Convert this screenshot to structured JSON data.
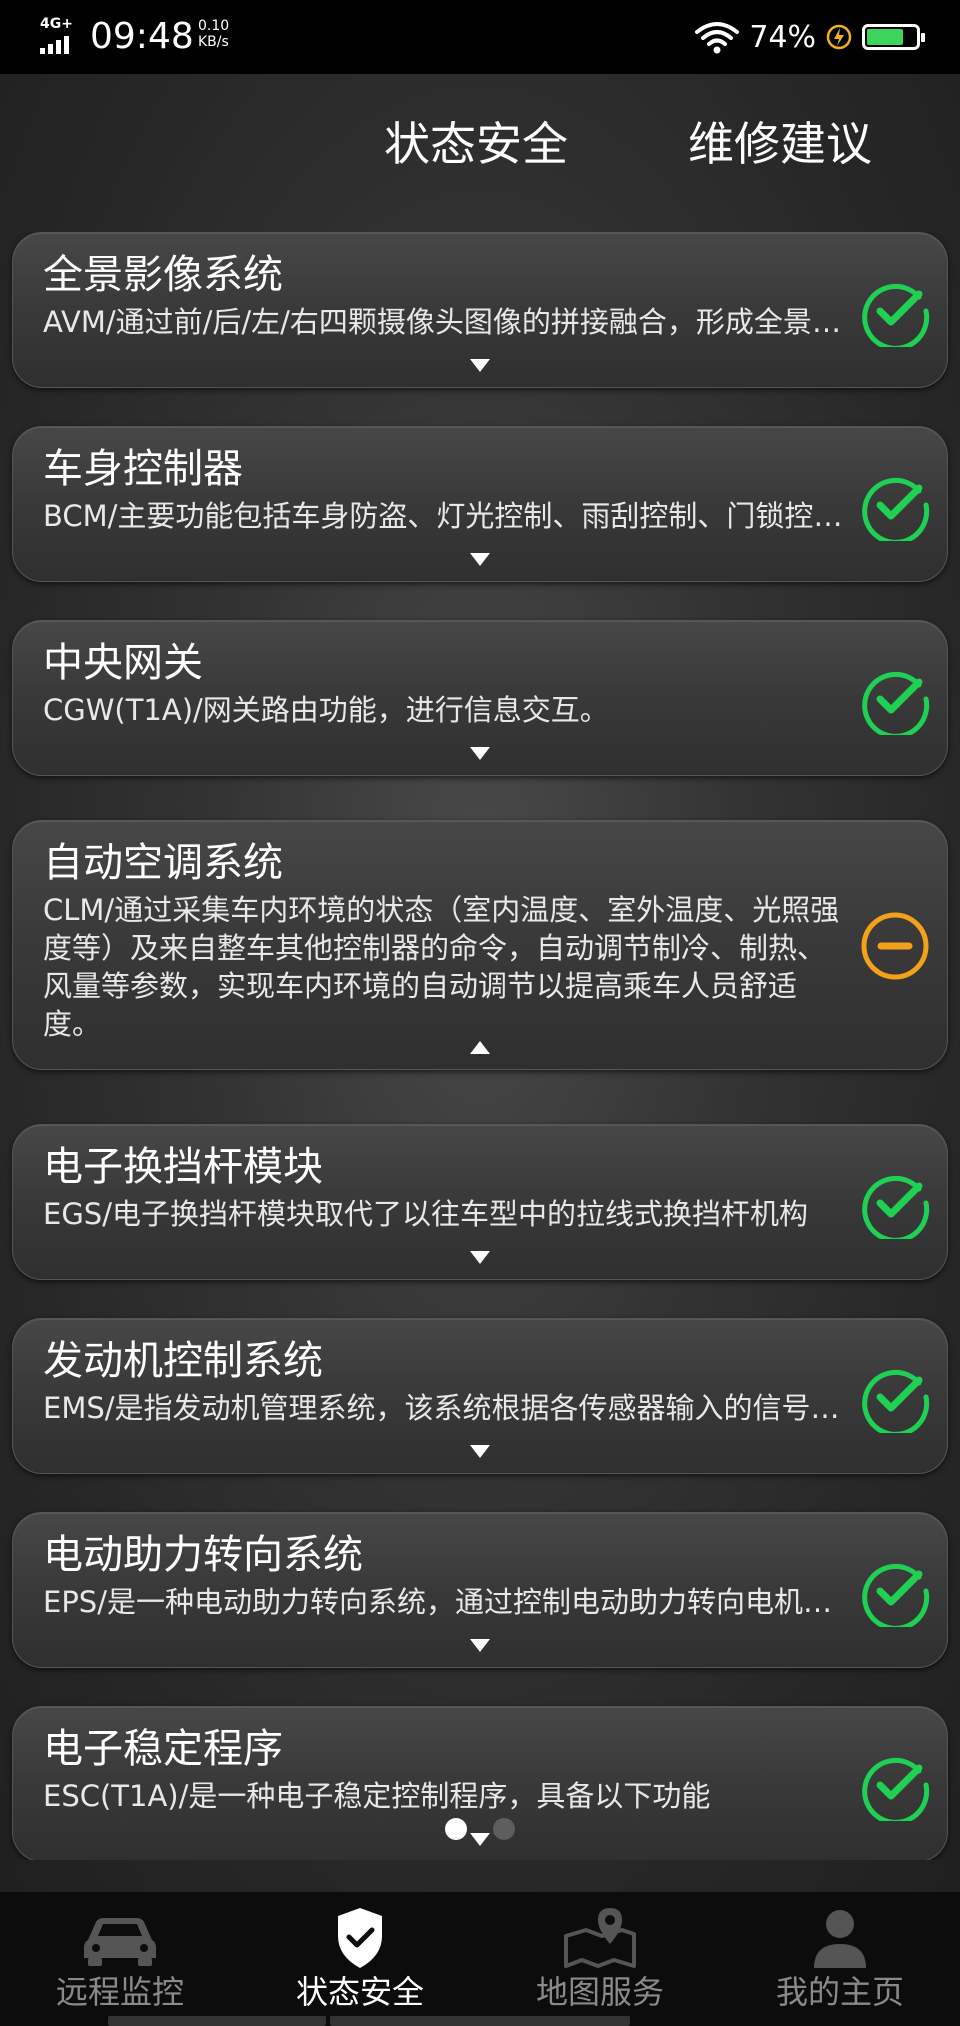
{
  "status_bar": {
    "network": "4G+",
    "time": "09:48",
    "speed_value": "0.10",
    "speed_unit": "KB/s",
    "battery_percent": "74%",
    "battery_level": 0.74,
    "battery_color": "#3cd45a"
  },
  "header": {
    "tabs": [
      {
        "label": "状态安全"
      },
      {
        "label": "维修建议"
      }
    ]
  },
  "colors": {
    "ok_green": "#1fd153",
    "warn_orange": "#f3a11b"
  },
  "systems": [
    {
      "title": "全景影像系统",
      "desc": "AVM/通过前/后/左/右四颗摄像头图像的拼接融合，形成全景影像并显示，辅助驾驶员泊车",
      "status": "ok",
      "expanded": false
    },
    {
      "title": "车身控制器",
      "desc": "BCM/主要功能包括车身防盗、灯光控制、雨刮控制、门锁控制等",
      "status": "ok",
      "expanded": false
    },
    {
      "title": "中央网关",
      "desc": "CGW(T1A)/网关路由功能，进行信息交互。",
      "status": "ok",
      "expanded": false
    },
    {
      "title": "自动空调系统",
      "desc": "CLM/通过采集车内环境的状态（室内温度、室外温度、光照强度等）及来自整车其他控制器的命令，自动调节制冷、制热、风量等参数，实现车内环境的自动调节以提高乘车人员舒适度。",
      "status": "warning",
      "expanded": true
    },
    {
      "title": "电子换挡杆模块",
      "desc": "EGS/电子换挡杆模块取代了以往车型中的拉线式换挡杆机构",
      "status": "ok",
      "expanded": false
    },
    {
      "title": "发动机控制系统",
      "desc": "EMS/是指发动机管理系统，该系统根据各传感器输入的信号控制发动机工作",
      "status": "ok",
      "expanded": false
    },
    {
      "title": "电动助力转向系统",
      "desc": "EPS/是一种电动助力转向系统，通过控制电动助力转向电机提供转向助力",
      "status": "ok",
      "expanded": false
    },
    {
      "title": "电子稳定程序",
      "desc": "ESC(T1A)/是一种电子稳定控制程序，具备以下功能",
      "status": "ok",
      "expanded": false
    }
  ],
  "pager": {
    "total": 2,
    "active": 1
  },
  "bottom_nav": [
    {
      "label": "远程监控",
      "icon": "car-icon",
      "active": false
    },
    {
      "label": "状态安全",
      "icon": "shield-check-icon",
      "active": true
    },
    {
      "label": "地图服务",
      "icon": "map-pin-icon",
      "active": false
    },
    {
      "label": "我的主页",
      "icon": "user-icon",
      "active": false
    }
  ]
}
